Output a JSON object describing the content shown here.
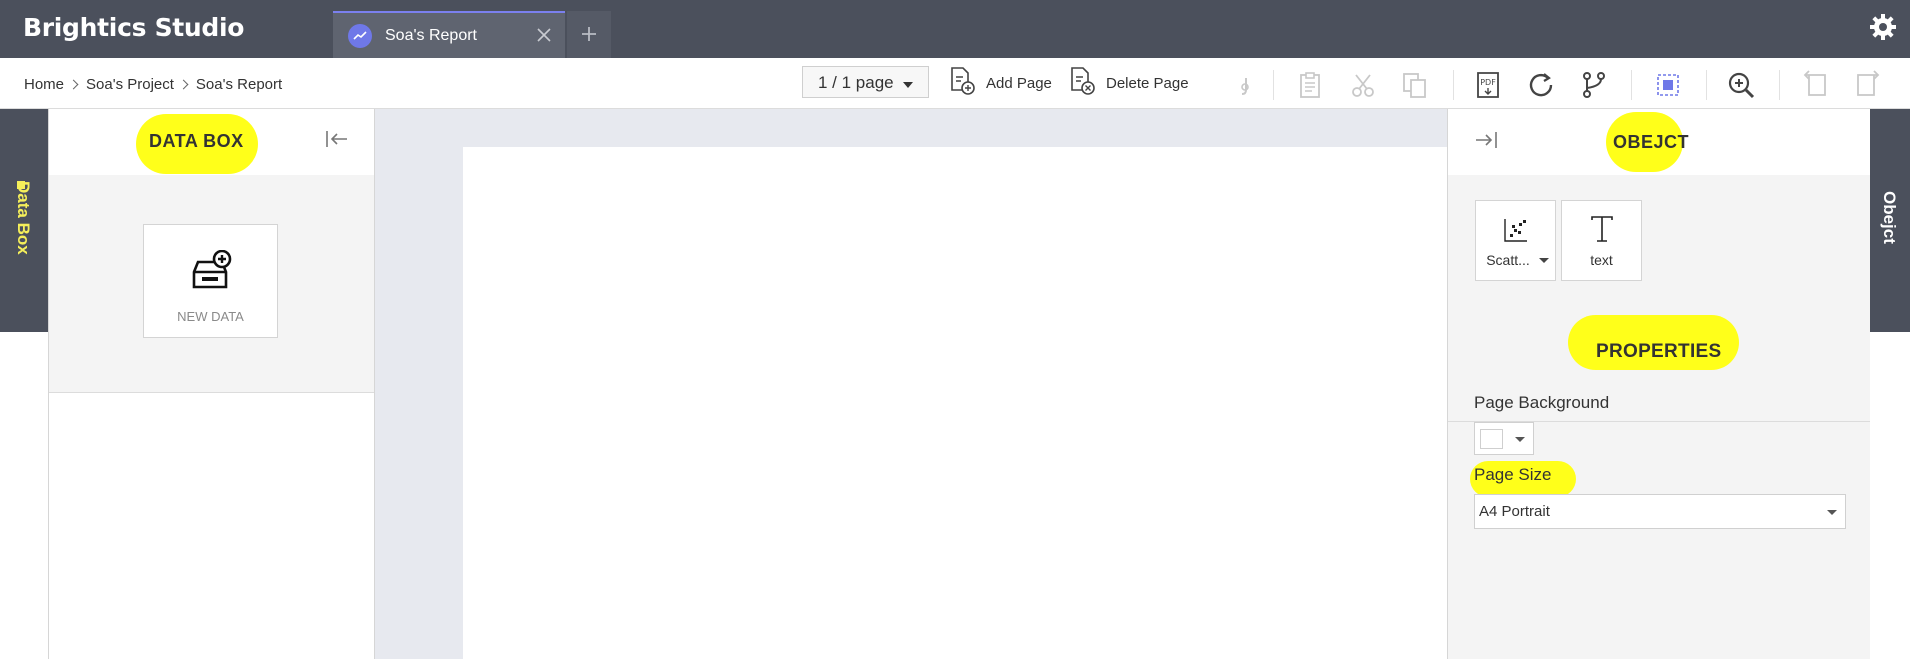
{
  "app": {
    "title": "Brightics Studio"
  },
  "tabs": [
    {
      "label": "Soa's Report"
    }
  ],
  "breadcrumb": [
    "Home",
    "Soa's Project",
    "Soa's Report"
  ],
  "toolbar": {
    "page_indicator": "1 / 1 page",
    "add_page_label": "Add Page",
    "delete_page_label": "Delete Page"
  },
  "left_sidetab": {
    "label": "Data Box"
  },
  "databox": {
    "title": "DATA BOX",
    "new_data_label": "NEW DATA"
  },
  "object_panel": {
    "title": "OBEJCT",
    "tiles": [
      {
        "label": "Scatt..."
      },
      {
        "label": "text"
      }
    ]
  },
  "properties": {
    "title": "PROPERTIES",
    "page_background_label": "Page Background",
    "page_size_label": "Page Size",
    "page_size_value": "A4 Portrait"
  },
  "right_sidetab": {
    "label": "Obejct"
  },
  "colors": {
    "titlebar": "#4b505c",
    "accent": "#6f78e8",
    "highlight": "#ffff1a",
    "canvas_bg": "#e7e9ef"
  },
  "icons": [
    "gear-icon",
    "chart-icon",
    "close-icon",
    "plus-icon",
    "add-page-icon",
    "delete-page-icon",
    "format-paint-icon",
    "paste-icon",
    "cut-icon",
    "copy-icon",
    "pdf-export-icon",
    "refresh-icon",
    "branch-icon",
    "select-area-icon",
    "zoom-in-icon",
    "undo-icon",
    "redo-icon",
    "collapse-left-icon",
    "expand-right-icon",
    "new-data-icon",
    "scatter-chart-icon",
    "text-icon"
  ]
}
